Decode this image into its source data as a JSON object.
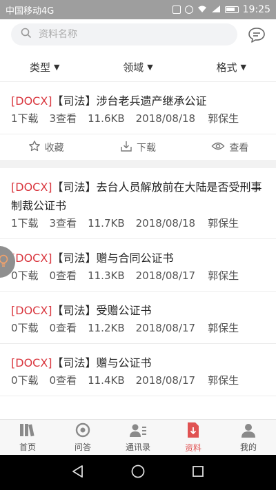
{
  "statusbar": {
    "carrier": "中国移动4G",
    "network": "4G",
    "time": "19:25"
  },
  "search": {
    "placeholder": "资料名称",
    "value": ""
  },
  "filters": [
    {
      "label": "类型"
    },
    {
      "label": "领域"
    },
    {
      "label": "格式"
    }
  ],
  "items": [
    {
      "format": "[DOCX]",
      "title": "【司法】涉台老兵遗产继承公证",
      "downloads": "1下载",
      "views": "3查看",
      "size": "11.6KB",
      "date": "2018/08/18",
      "author": "郭保生"
    },
    {
      "format": "[DOCX]",
      "title": "【司法】去台人员解放前在大陆是否受刑事制裁公证书",
      "downloads": "1下载",
      "views": "3查看",
      "size": "11.7KB",
      "date": "2018/08/18",
      "author": "郭保生"
    },
    {
      "format": "[DOCX]",
      "title": "【司法】赠与合同公证书",
      "downloads": "0下载",
      "views": "0查看",
      "size": "11.3KB",
      "date": "2018/08/17",
      "author": "郭保生"
    },
    {
      "format": "[DOCX]",
      "title": "【司法】受赠公证书",
      "downloads": "0下载",
      "views": "0查看",
      "size": "11.2KB",
      "date": "2018/08/17",
      "author": "郭保生"
    },
    {
      "format": "[DOCX]",
      "title": "【司法】赠与公证书",
      "downloads": "0下载",
      "views": "0查看",
      "size": "11.4KB",
      "date": "2018/08/17",
      "author": "郭保生"
    }
  ],
  "actions": {
    "favorite": "收藏",
    "download": "下载",
    "view": "查看"
  },
  "nav": [
    {
      "label": "首页",
      "icon": "books-icon"
    },
    {
      "label": "问答",
      "icon": "qa-icon"
    },
    {
      "label": "通讯录",
      "icon": "contacts-icon"
    },
    {
      "label": "资料",
      "icon": "file-download-icon",
      "active": true
    },
    {
      "label": "我的",
      "icon": "person-icon"
    }
  ],
  "colors": {
    "accent": "#e05252",
    "format_tag": "#d9363e",
    "statusbar": "#9e9e9e"
  }
}
